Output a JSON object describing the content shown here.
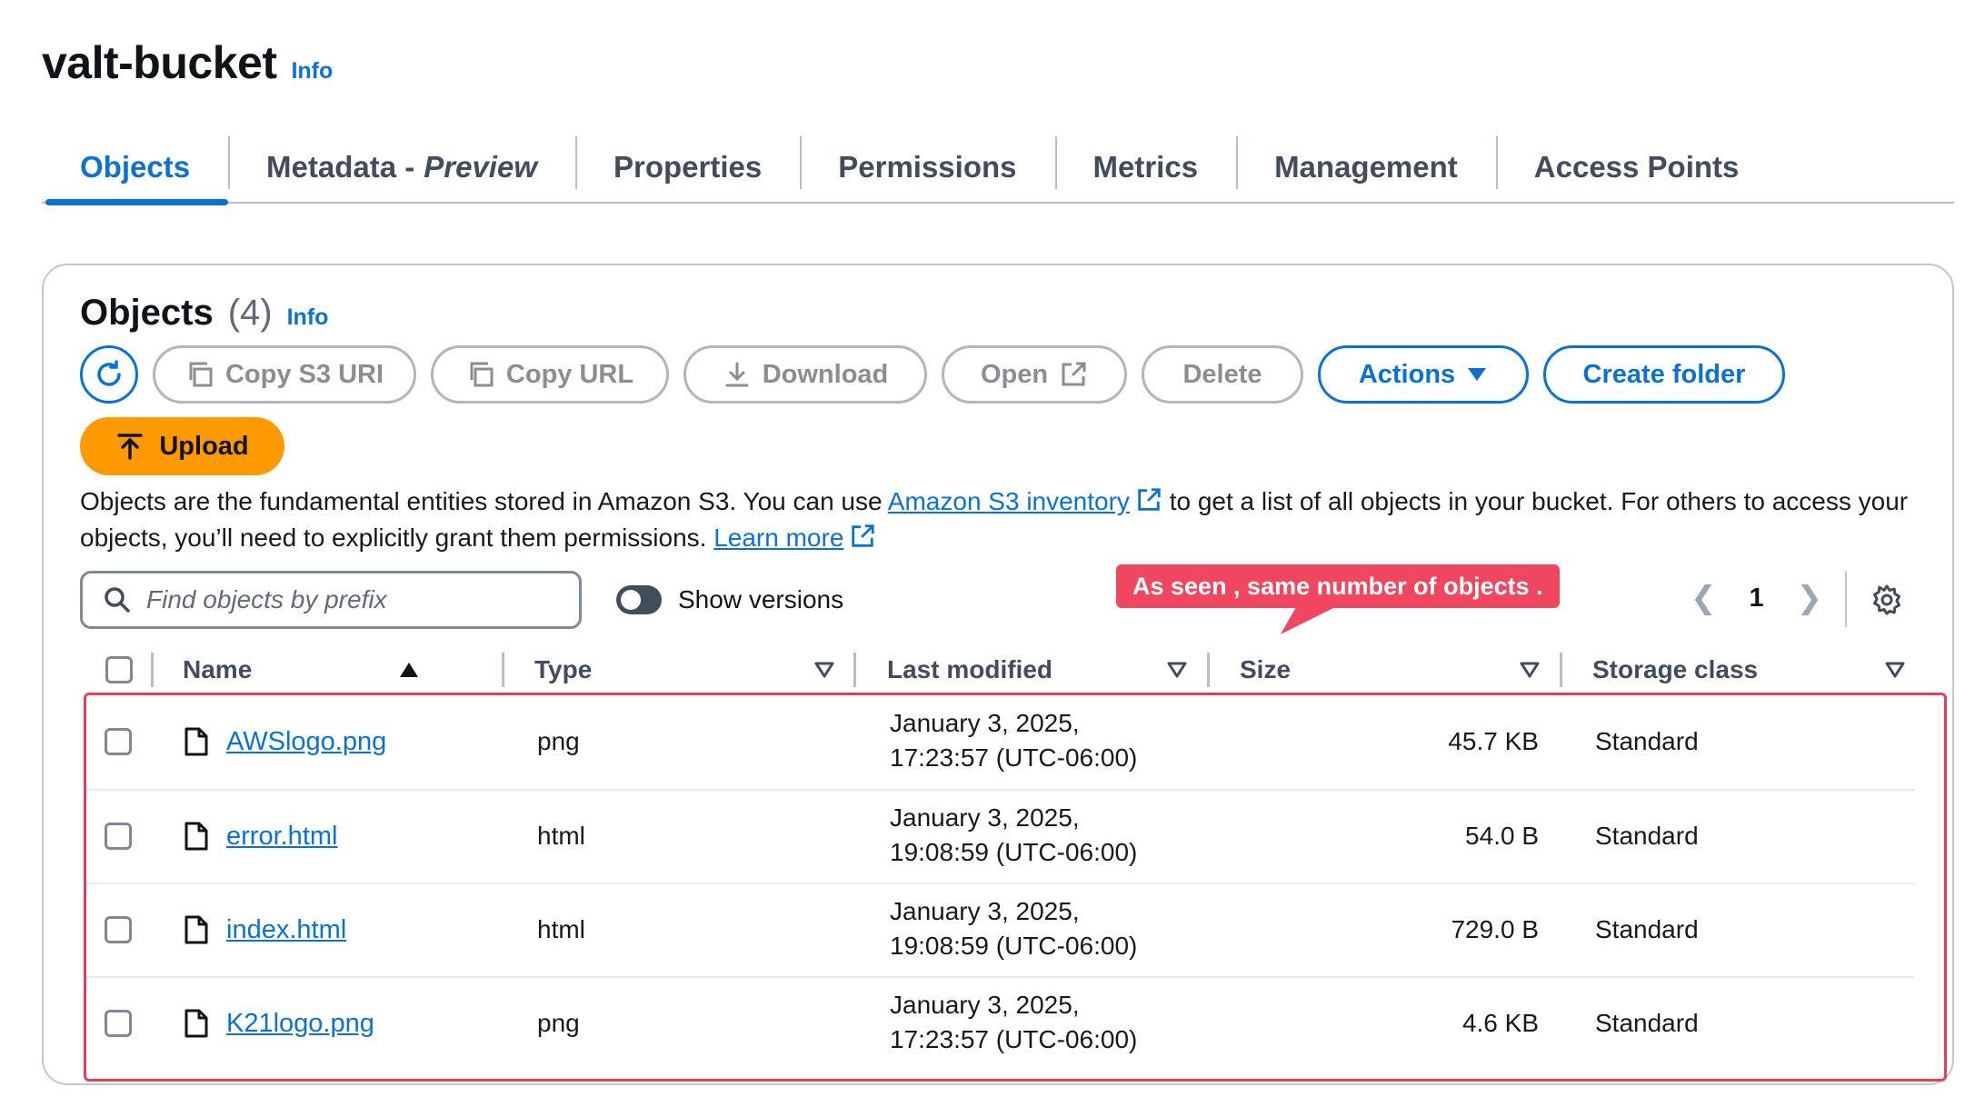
{
  "bucket": {
    "title": "valt-bucket",
    "info_label": "Info"
  },
  "tabs": [
    {
      "label": "Objects",
      "suffix": ""
    },
    {
      "label": "Metadata -",
      "suffix": "Preview"
    },
    {
      "label": "Properties",
      "suffix": ""
    },
    {
      "label": "Permissions",
      "suffix": ""
    },
    {
      "label": "Metrics",
      "suffix": ""
    },
    {
      "label": "Management",
      "suffix": ""
    },
    {
      "label": "Access Points",
      "suffix": ""
    }
  ],
  "objects_panel": {
    "title": "Objects",
    "count": "(4)",
    "info_label": "Info",
    "buttons": {
      "refresh_icon": "refresh-icon",
      "copy_s3_uri": "Copy S3 URI",
      "copy_url": "Copy URL",
      "download": "Download",
      "open": "Open",
      "delete": "Delete",
      "actions": "Actions",
      "create_folder": "Create folder",
      "upload": "Upload"
    },
    "description": {
      "part1": "Objects are the fundamental entities stored in Amazon S3. You can use ",
      "link1": "Amazon S3 inventory",
      "part2": " to get a list of all objects in your bucket. For others to access your objects, you’ll need to explicitly grant them permissions. ",
      "link2": "Learn more"
    },
    "search": {
      "placeholder": "Find objects by prefix",
      "value": ""
    },
    "show_versions_label": "Show versions",
    "show_versions_on": false,
    "pagination": {
      "current_page": "1"
    },
    "annotation": "As seen , same number of objects ."
  },
  "table": {
    "columns": {
      "name": "Name",
      "type": "Type",
      "last_modified": "Last modified",
      "size": "Size",
      "storage_class": "Storage class"
    },
    "rows": [
      {
        "name": "AWSlogo.png",
        "type": "png",
        "modified_date": "January 3, 2025,",
        "modified_time": "17:23:57 (UTC-06:00)",
        "size": "45.7 KB",
        "storage_class": "Standard"
      },
      {
        "name": "error.html",
        "type": "html",
        "modified_date": "January 3, 2025,",
        "modified_time": "19:08:59 (UTC-06:00)",
        "size": "54.0 B",
        "storage_class": "Standard"
      },
      {
        "name": "index.html",
        "type": "html",
        "modified_date": "January 3, 2025,",
        "modified_time": "19:08:59 (UTC-06:00)",
        "size": "729.0 B",
        "storage_class": "Standard"
      },
      {
        "name": "K21logo.png",
        "type": "png",
        "modified_date": "January 3, 2025,",
        "modified_time": "17:23:57 (UTC-06:00)",
        "size": "4.6 KB",
        "storage_class": "Standard"
      }
    ]
  },
  "colors": {
    "link_blue": "#0972d3",
    "upload_orange": "#ff9900",
    "annotation_red": "#f0465f",
    "highlight_border": "#e0405a"
  }
}
